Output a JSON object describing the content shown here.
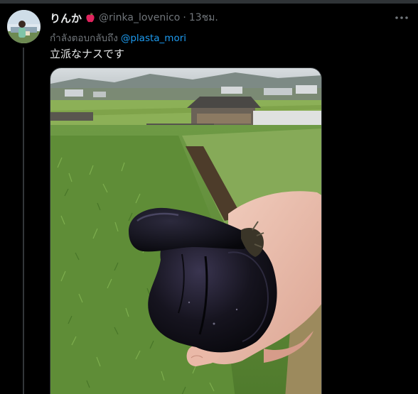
{
  "tweet": {
    "display_name": "りんか",
    "name_emoji": "red-apple-icon",
    "handle": "@rinka_lovenico",
    "separator": "·",
    "time": "13ชม.",
    "replying_prefix": "กำลังตอบกลับถึง",
    "replying_to": "@plasta_mori",
    "text": "立派なナスです",
    "more_icon": "more-horizontal-icon",
    "media_description_icon": "photo-eggplant-in-hand"
  },
  "colors": {
    "background": "#000000",
    "primary_text": "#e7e9ea",
    "secondary_text": "#71767b",
    "link": "#1d9bf0",
    "divider": "#2f3336"
  }
}
